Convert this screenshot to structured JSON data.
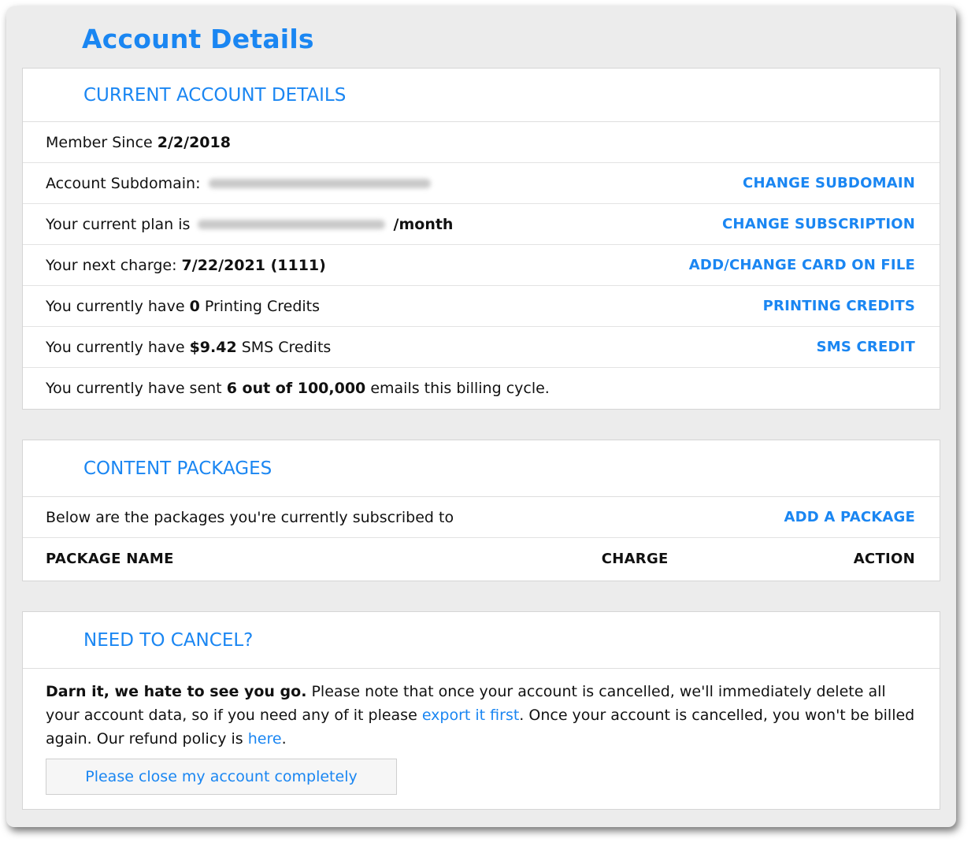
{
  "page": {
    "title": "Account Details"
  },
  "colors": {
    "accent": "#1a86f2",
    "background": "#ececec"
  },
  "current": {
    "title": "CURRENT ACCOUNT DETAILS",
    "member_since_label": "Member Since",
    "member_since_date": "2/2/2018",
    "subdomain_label": "Account Subdomain:",
    "change_subdomain": "CHANGE SUBDOMAIN",
    "plan_prefix": "Your current plan is",
    "plan_suffix": "/month",
    "change_subscription": "CHANGE SUBSCRIPTION",
    "next_charge_label": "Your next charge:",
    "next_charge_value": "7/22/2021 (1111)",
    "change_card": "ADD/CHANGE CARD ON FILE",
    "printing_prefix": "You currently have",
    "printing_value": "0",
    "printing_suffix": "Printing Credits",
    "printing_link": "PRINTING CREDITS",
    "sms_prefix": "You currently have",
    "sms_value": "$9.42",
    "sms_suffix": "SMS Credits",
    "sms_link": "SMS CREDIT",
    "emails_prefix": "You currently have sent",
    "emails_value": "6 out of 100,000",
    "emails_suffix": "emails this billing cycle."
  },
  "packages": {
    "title": "CONTENT PACKAGES",
    "intro": "Below are the packages you're currently subscribed to",
    "add_link": "ADD A PACKAGE",
    "columns": [
      "PACKAGE NAME",
      "CHARGE",
      "ACTION"
    ]
  },
  "cancel": {
    "title": "NEED TO CANCEL?",
    "lead": "Darn it, we hate to see you go.",
    "text1": "Please note that once your account is cancelled, we'll immediately delete all your account data, so if you need any of it please",
    "export_link": "export it first",
    "text2": ". Once your account is cancelled, you won't be billed again. Our refund policy is",
    "refund_link": "here",
    "text3": ".",
    "button": "Please close my account completely"
  }
}
